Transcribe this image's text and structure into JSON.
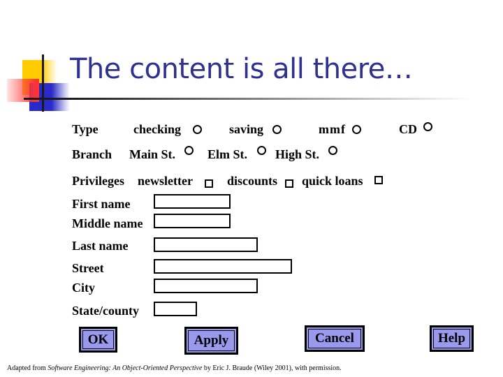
{
  "slide": {
    "title": "The content is all there…",
    "credit": {
      "prefix": "Adapted from ",
      "book": "Software Engineering: An Object-Oriented Perspective",
      "suffix": " by Eric J. Braude (Wiley 2001), with permission."
    }
  },
  "form": {
    "type": {
      "label": "Type",
      "options": [
        "checking",
        "saving",
        "mmf",
        "CD"
      ]
    },
    "branch": {
      "label": "Branch",
      "options": [
        "Main St.",
        "Elm St.",
        "High St."
      ]
    },
    "privileges": {
      "label": "Privileges",
      "options": [
        "newsletter",
        "discounts",
        "quick loans"
      ]
    },
    "fields": {
      "first_name": {
        "label": "First name",
        "value": ""
      },
      "middle_name": {
        "label": "Middle name",
        "value": ""
      },
      "last_name": {
        "label": "Last name",
        "value": ""
      },
      "street": {
        "label": "Street",
        "value": ""
      },
      "city": {
        "label": "City",
        "value": ""
      },
      "state_county": {
        "label": "State/county",
        "value": ""
      }
    },
    "buttons": {
      "ok": "OK",
      "apply": "Apply",
      "cancel": "Cancel",
      "help": "Help"
    }
  }
}
